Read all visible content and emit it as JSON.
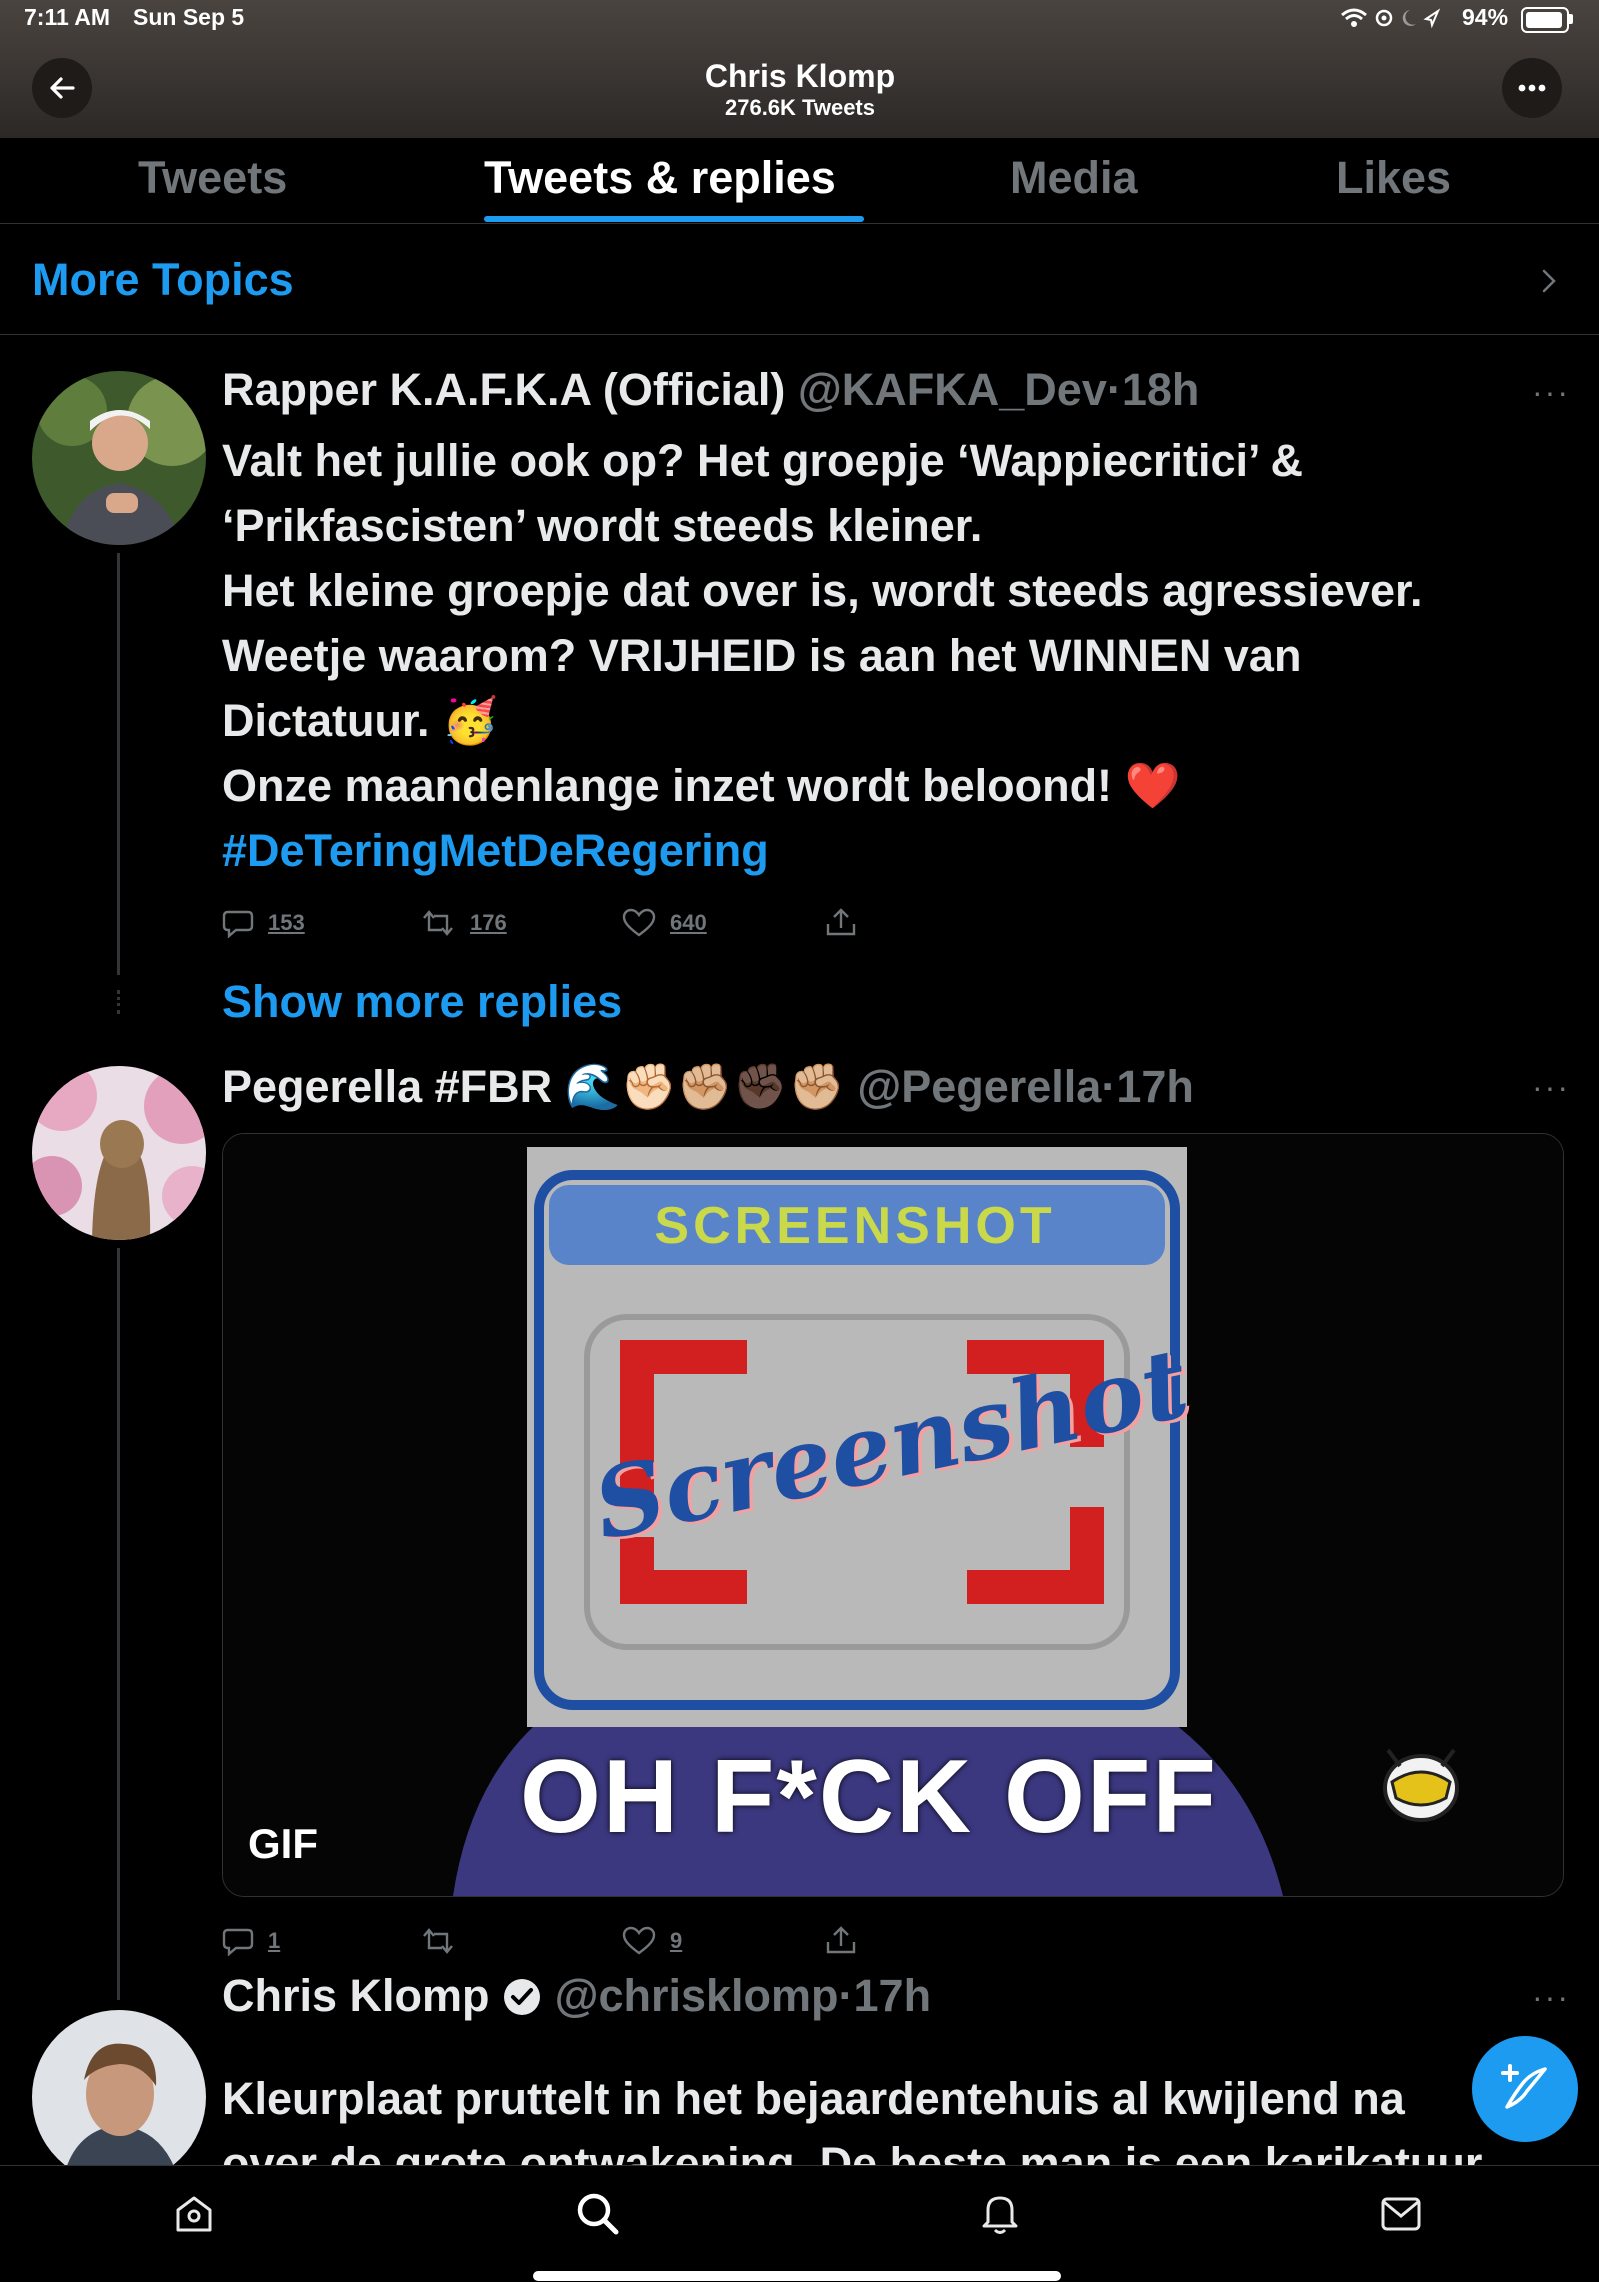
{
  "status_bar": {
    "time": "7:11 AM",
    "date": "Sun Sep 5",
    "battery": "94%"
  },
  "header": {
    "title": "Chris Klomp",
    "subtitle": "276.6K Tweets"
  },
  "tabs": [
    {
      "label": "Tweets",
      "active": false
    },
    {
      "label": "Tweets & replies",
      "active": true
    },
    {
      "label": "Media",
      "active": false
    },
    {
      "label": "Likes",
      "active": false
    }
  ],
  "more_topics": {
    "label": "More Topics"
  },
  "tweets": [
    {
      "name": "Rapper K.A.F.K.A (Official)",
      "handle": "@KAFKA_Dev",
      "time": "18h",
      "lines": [
        "Valt het jullie ook op? Het groepje ‘Wappiecritici’ &",
        "‘Prikfascisten’ wordt steeds kleiner.",
        "Het kleine groepje dat over is, wordt steeds agressiever.",
        "Weetje waarom? VRIJHEID is aan het WINNEN van",
        "Dictatuur. 🥳",
        "Onze maandenlange inzet wordt beloond! ❤️"
      ],
      "hashtag": "#DeTeringMetDeRegering",
      "replies": "153",
      "retweets": "176",
      "likes": "640"
    },
    {
      "name": "Pegerella #FBR 🌊✊🏻✊🏼✊🏿✊🏼",
      "handle": "@Pegerella",
      "time": "17h",
      "media": {
        "type": "GIF",
        "gif_label": "GIF",
        "sticker_top_text": "SCREENSHOT",
        "sticker_script_text": "Screenshot",
        "caption": "OH F*CK OFF"
      },
      "replies": "1",
      "retweets": "",
      "likes": "9"
    },
    {
      "name": "Chris Klomp",
      "verified": true,
      "handle": "@chrisklomp",
      "time": "17h",
      "lines": [
        "Kleurplaat pruttelt in het bejaardentehuis al kwijlend na",
        "over de grote ontwakening. De beste man is een karikatuur"
      ]
    }
  ],
  "show_more_replies": "Show more replies",
  "bottom_nav": [
    "home-icon",
    "search-icon",
    "notifications-icon",
    "messages-icon"
  ],
  "colors": {
    "accent": "#1d9bf0",
    "background": "#000000",
    "muted": "#71767b"
  }
}
